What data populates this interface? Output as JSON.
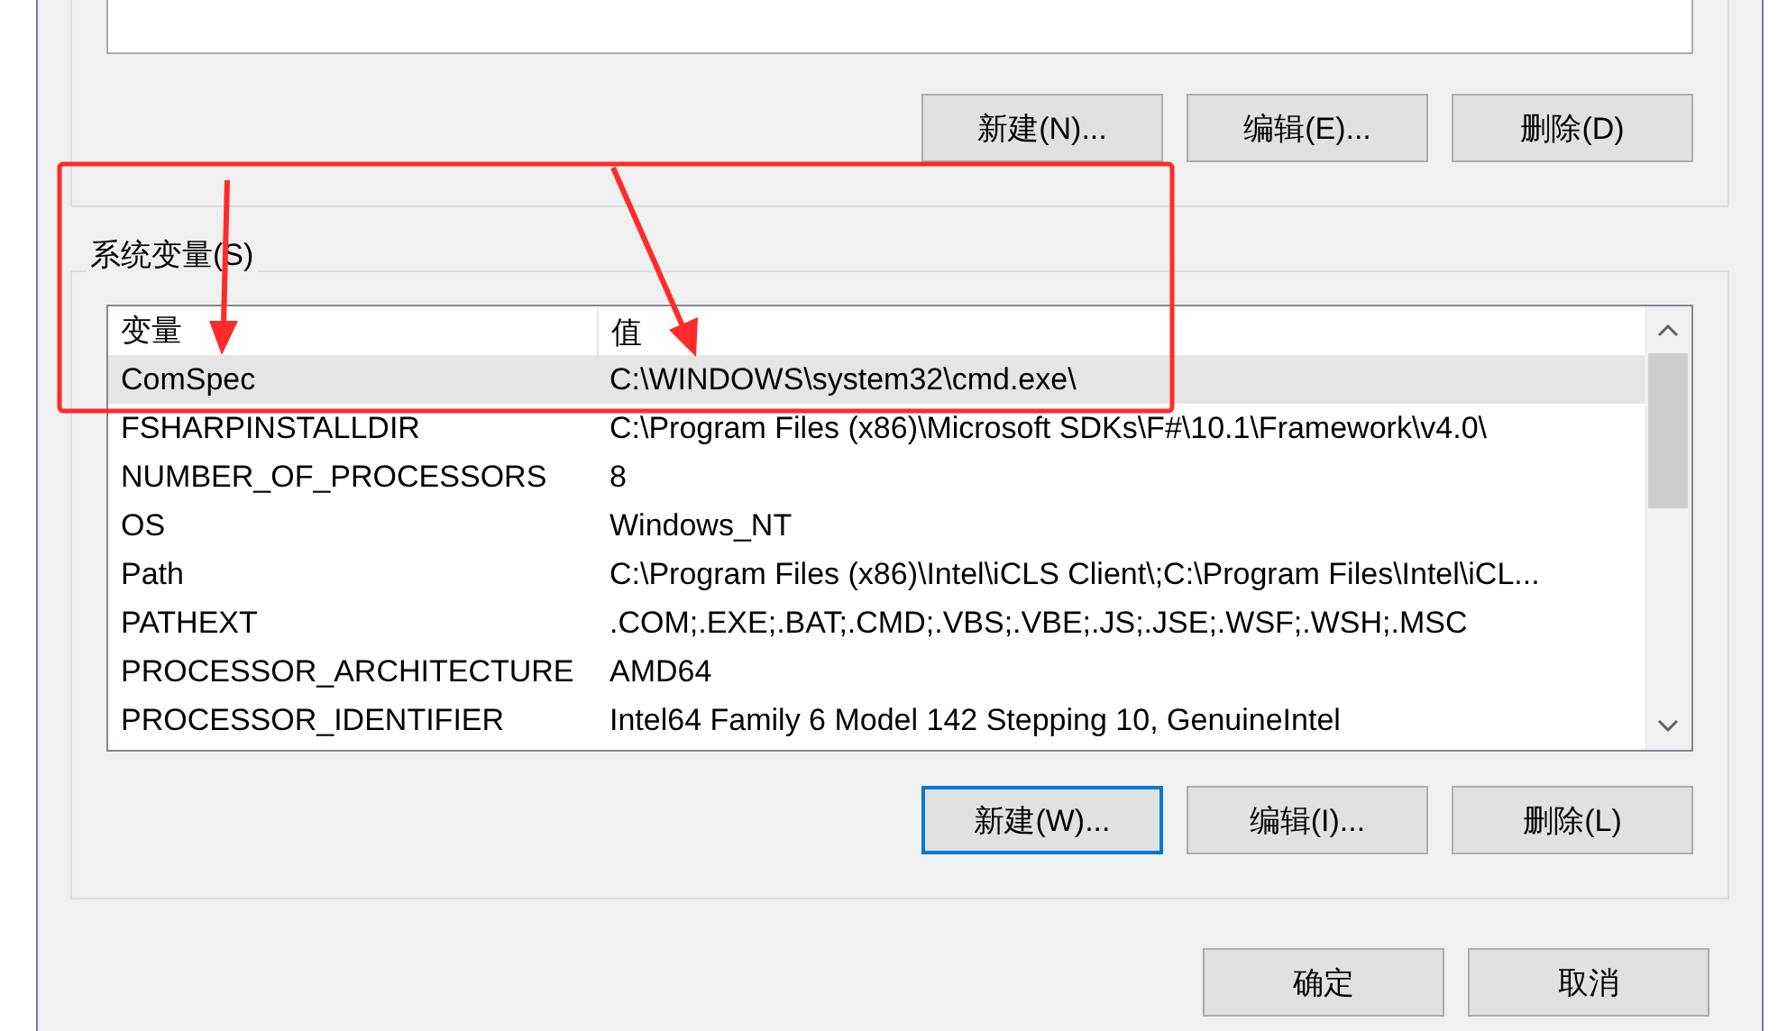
{
  "user_variables": {
    "buttons": [
      {
        "label": "新建(N)...",
        "focused": false
      },
      {
        "label": "编辑(E)...",
        "focused": false
      },
      {
        "label": "删除(D)",
        "focused": false
      }
    ]
  },
  "system_variables": {
    "title": "系统变量(S)",
    "columns": [
      "变量",
      "值"
    ],
    "rows": [
      {
        "name": "ComSpec",
        "value": "C:\\WINDOWS\\system32\\cmd.exe\\",
        "selected": true
      },
      {
        "name": "FSHARPINSTALLDIR",
        "value": "C:\\Program Files (x86)\\Microsoft SDKs\\F#\\10.1\\Framework\\v4.0\\",
        "selected": false
      },
      {
        "name": "NUMBER_OF_PROCESSORS",
        "value": "8",
        "selected": false
      },
      {
        "name": "OS",
        "value": "Windows_NT",
        "selected": false
      },
      {
        "name": "Path",
        "value": "C:\\Program Files (x86)\\Intel\\iCLS Client\\;C:\\Program Files\\Intel\\iCL...",
        "selected": false
      },
      {
        "name": "PATHEXT",
        "value": ".COM;.EXE;.BAT;.CMD;.VBS;.VBE;.JS;.JSE;.WSF;.WSH;.MSC",
        "selected": false
      },
      {
        "name": "PROCESSOR_ARCHITECTURE",
        "value": "AMD64",
        "selected": false
      },
      {
        "name": "PROCESSOR_IDENTIFIER",
        "value": "Intel64 Family 6 Model 142 Stepping 10, GenuineIntel",
        "selected": false
      }
    ],
    "buttons": [
      {
        "label": "新建(W)...",
        "focused": true
      },
      {
        "label": "编辑(I)...",
        "focused": false
      },
      {
        "label": "删除(L)",
        "focused": false
      }
    ]
  },
  "dialog_buttons": [
    {
      "label": "确定",
      "focused": false
    },
    {
      "label": "取消",
      "focused": false
    }
  ]
}
